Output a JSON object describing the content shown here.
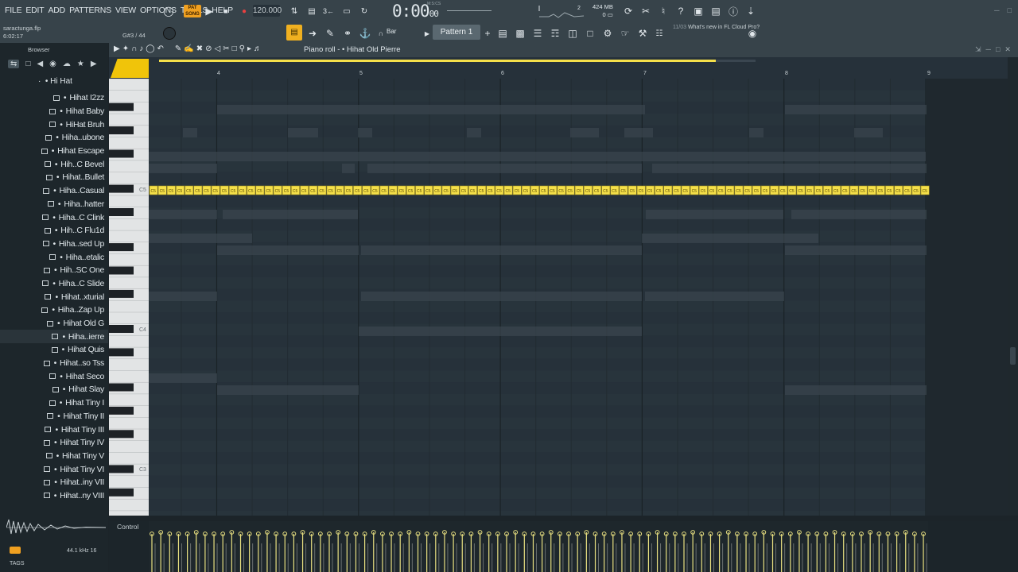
{
  "menu": [
    "FILE",
    "EDIT",
    "ADD",
    "PATTERNS",
    "VIEW",
    "OPTIONS",
    "TOOLS",
    "HELP"
  ],
  "transport": {
    "mode": "SONG",
    "mode_top": "PAT",
    "tempo": "120.000",
    "time": "0:00",
    "time_sub": "00",
    "time_label": "M:S:CS"
  },
  "monitor": {
    "cpu": "2",
    "memory": "424 MB",
    "poly": "0"
  },
  "news": {
    "date": "11/03",
    "text": "What's new in FL Cloud Pro?"
  },
  "project": {
    "file": "saractunga.flp",
    "time": "6:02:17"
  },
  "hint": "G#3 / 44",
  "snap": "Bar",
  "pattern": "Pattern 1",
  "browser": {
    "title": "Browser",
    "folder": "Hi Hat",
    "items": [
      "Hihat I2zz",
      "Hihat Baby",
      "HiHat Bruh",
      "Hiha..ubone",
      "Hihat Escape",
      "Hih..C Bevel",
      "Hihat..Bullet",
      "Hiha..Casual",
      "Hiha..hatter",
      "Hiha..C Clink",
      "Hih..C Flu1d",
      "Hiha..sed Up",
      "Hiha..etalic",
      "Hih..SC One",
      "Hiha..C Slide",
      "Hihat..xturial",
      "Hiha..Zap Up",
      "Hihat Old G",
      "Hiha..ierre",
      "Hihat Quis",
      "Hihat..so Tss",
      "Hihat Seco",
      "Hihat Slay",
      "Hihat Tiny I",
      "Hihat Tiny II",
      "Hihat Tiny III",
      "Hihat Tiny IV",
      "Hihat Tiny V",
      "Hihat Tiny VI",
      "Hihat..iny VII",
      "Hihat..ny VIII"
    ],
    "selected_index": 18,
    "sample_rate": "44.1 kHz 16",
    "tags": "TAGS"
  },
  "piano_roll": {
    "title": "Piano roll - • Hihat Old Pierre",
    "bars": [
      "4",
      "5",
      "6",
      "7",
      "8",
      "9"
    ],
    "key_labels": [
      "C5",
      "C4",
      "C3"
    ],
    "note_label": "C5",
    "control": "Control",
    "accent": "#f5e04a"
  }
}
